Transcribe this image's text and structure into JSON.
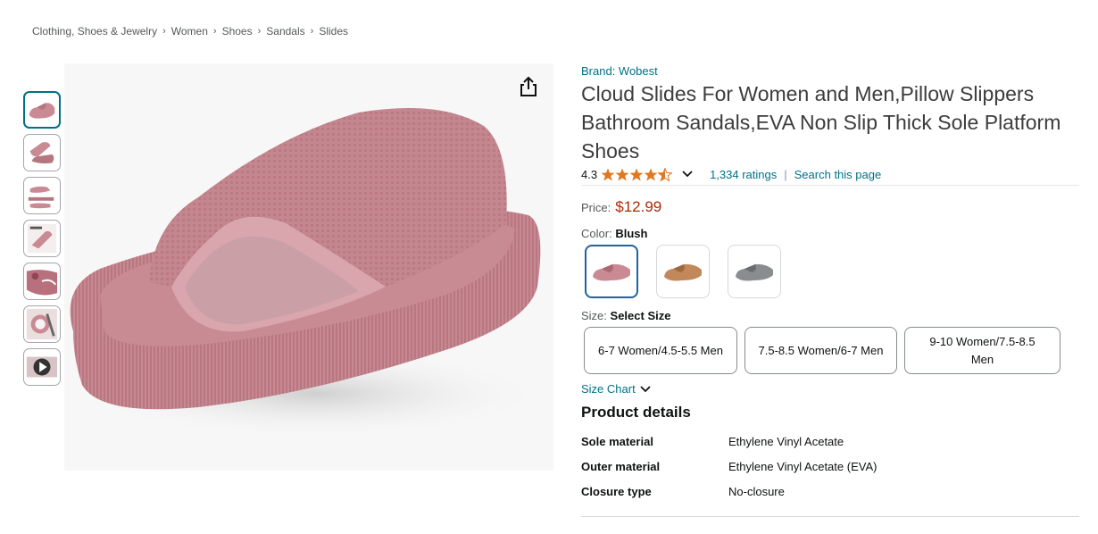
{
  "breadcrumb": [
    "Clothing, Shoes & Jewelry",
    "Women",
    "Shoes",
    "Sandals",
    "Slides"
  ],
  "breadcrumb_sep": "›",
  "thumbnails": [
    {
      "icon": "sandal-pink-thumbnail",
      "active": true
    },
    {
      "icon": "sandal-pair-thumbnail"
    },
    {
      "icon": "sandal-angles-thumbnail"
    },
    {
      "icon": "sandal-infographic-thumbnail"
    },
    {
      "icon": "sandal-closeup-thumbnail"
    },
    {
      "icon": "sandal-lifestyle-thumbnail"
    },
    {
      "icon": "video-play-thumbnail"
    }
  ],
  "product": {
    "brand": "Brand: Wobest",
    "title": "Cloud Slides For Women and Men,Pillow Slippers Bathroom Sandals,EVA Non Slip Thick Sole Platform Shoes",
    "rating": "4.3",
    "rating_value": 4.3,
    "ratings_count": "1,334 ratings",
    "pipe": "|",
    "search_link": "Search this page",
    "price_label": "Price:",
    "price": "$12.99",
    "color_label": "Color:",
    "color_selected": "Blush",
    "colors": [
      {
        "name": "Blush",
        "hex": "#c98a93",
        "active": true
      },
      {
        "name": "Brown",
        "hex": "#c2885a"
      },
      {
        "name": "Grey",
        "hex": "#8a8d90"
      }
    ],
    "size_label": "Size:",
    "size_selected": "Select Size",
    "sizes": [
      "6-7 Women/4.5-5.5 Men",
      "7.5-8.5 Women/6-7 Men",
      "9-10 Women/7.5-8.5 Men"
    ],
    "size_chart": "Size Chart",
    "details_title": "Product details",
    "details": [
      {
        "key": "Sole material",
        "value": "Ethylene Vinyl Acetate"
      },
      {
        "key": "Outer material",
        "value": "Ethylene Vinyl Acetate (EVA)"
      },
      {
        "key": "Closure type",
        "value": "No-closure"
      }
    ]
  },
  "colors": {
    "link": "#007185",
    "price": "#b12704",
    "star": "#de7921",
    "selected_border": "#2162a1"
  }
}
